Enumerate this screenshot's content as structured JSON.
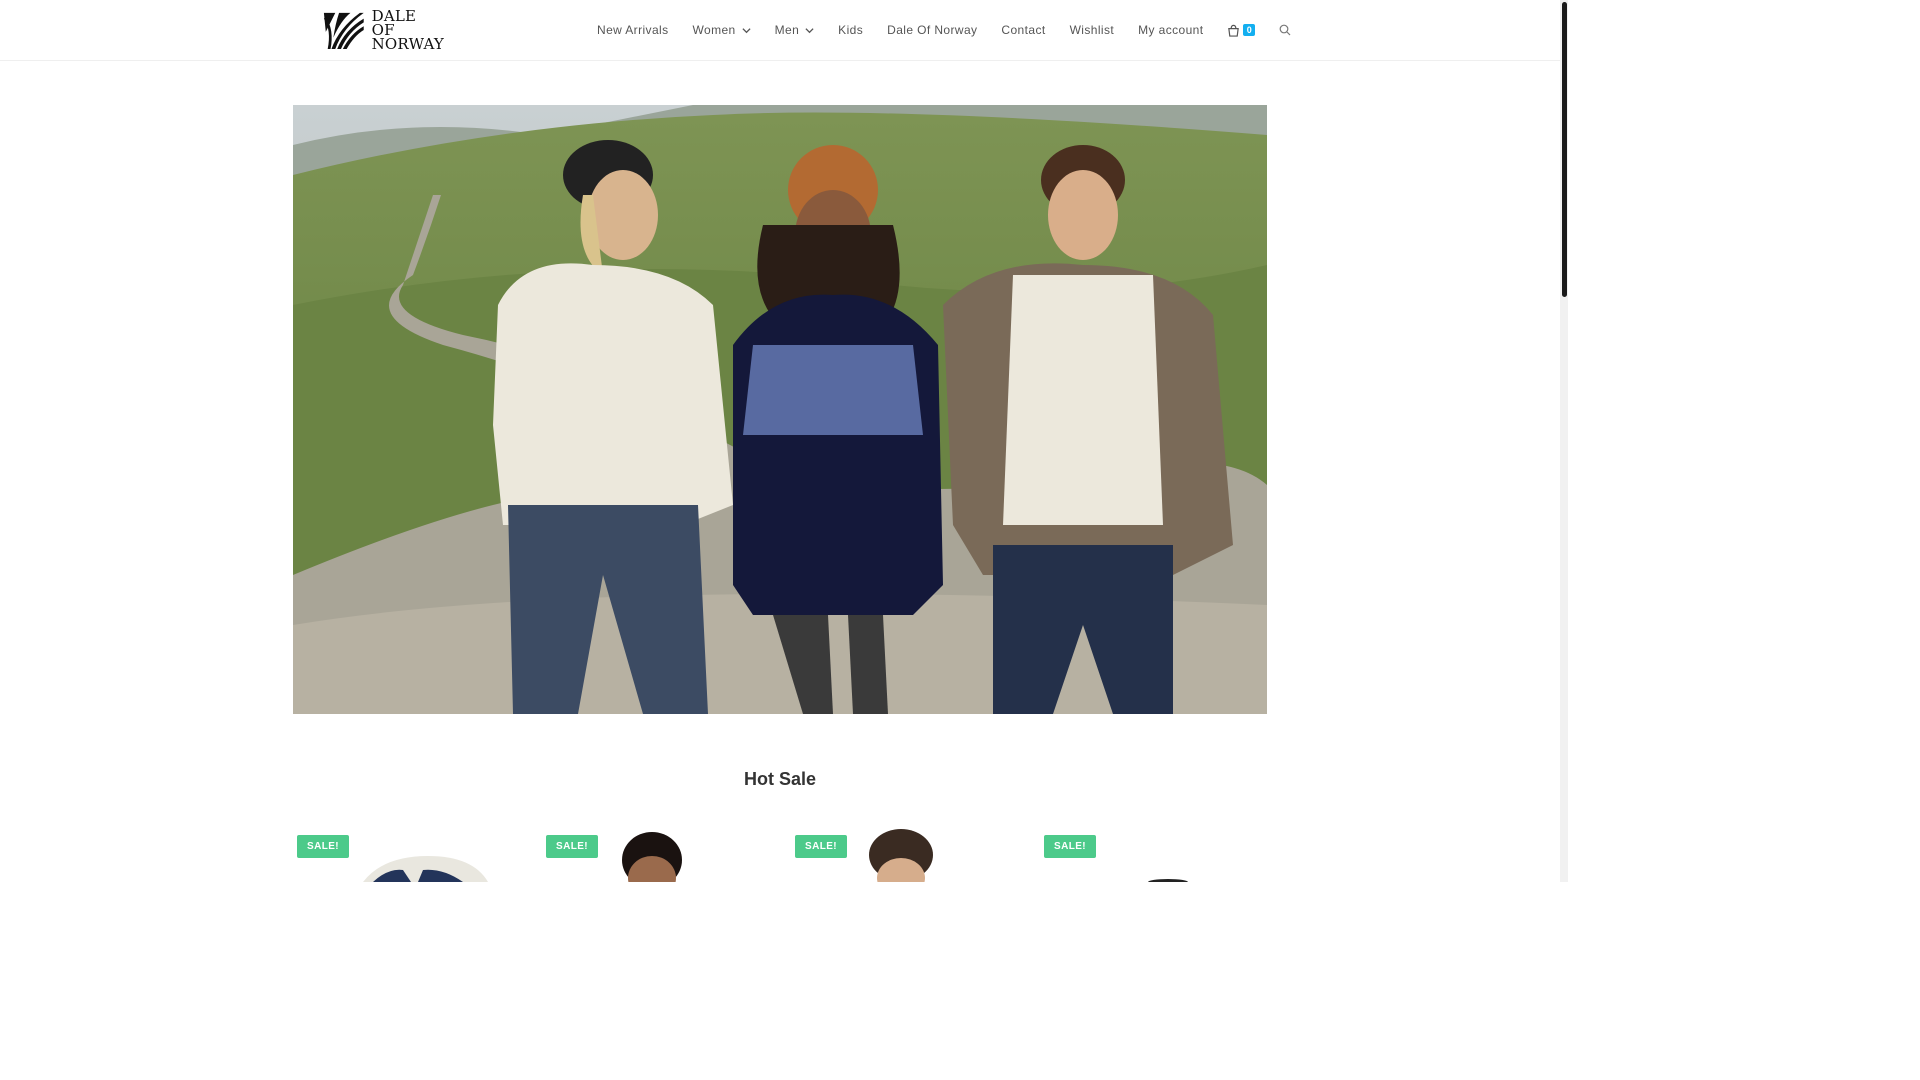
{
  "brand": {
    "logo_lines": [
      "DALE",
      "OF",
      "NORWAY"
    ]
  },
  "nav": {
    "items": [
      {
        "label": "New Arrivals",
        "has_dropdown": false
      },
      {
        "label": "Women",
        "has_dropdown": true
      },
      {
        "label": "Men",
        "has_dropdown": true
      },
      {
        "label": "Kids",
        "has_dropdown": false
      },
      {
        "label": "Dale Of Norway",
        "has_dropdown": false
      },
      {
        "label": "Contact",
        "has_dropdown": false
      },
      {
        "label": "Wishlist",
        "has_dropdown": false
      },
      {
        "label": "My account",
        "has_dropdown": false
      }
    ],
    "cart_count": "0",
    "cart_icon": "shopping-bag-icon",
    "search_icon": "search-icon"
  },
  "hero": {
    "image": "hero-banner-three-models-knitwear-mountain-road"
  },
  "hot_sale": {
    "title": "Hot Sale",
    "products": [
      {
        "badge": "SALE!"
      },
      {
        "badge": "SALE!"
      },
      {
        "badge": "SALE!"
      },
      {
        "badge": "SALE!"
      }
    ]
  },
  "colors": {
    "accent": "#13aff0",
    "sale": "#4cca8a",
    "text": "#555555"
  }
}
